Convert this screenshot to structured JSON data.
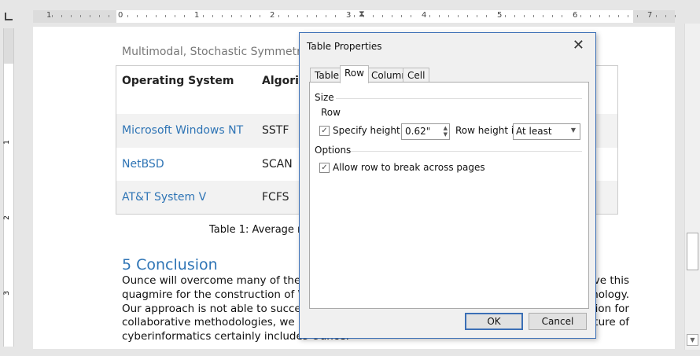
{
  "ruler": {
    "numbers_left": [
      "1"
    ],
    "numbers": [
      "0",
      "1",
      "2",
      "3",
      "4",
      "5",
      "6",
      "7"
    ],
    "vertical_numbers": [
      "1",
      "2",
      "3"
    ]
  },
  "document": {
    "running_header": "Multimodal, Stochastic Symmetries f",
    "table": {
      "headers": [
        "Operating System",
        "Algorit"
      ],
      "rows": [
        [
          "Microsoft Windows NT",
          "SSTF"
        ],
        [
          "NetBSD",
          "SCAN"
        ],
        [
          "AT&T System V",
          "FCFS"
        ]
      ]
    },
    "caption": "Table 1: Average res",
    "section_heading": "5 Conclusion",
    "paragraph_left": [
      "Ounce will overcome many of the g",
      "quagmire for the construction of Web",
      "Our approach is not able to successf",
      "collaborative methodologies, we intro",
      "cyberinformatics certainly includes Ounce."
    ],
    "paragraph_right": [
      "ve this",
      "nology.",
      "sion for",
      "uture of"
    ]
  },
  "dialog": {
    "title": "Table Properties",
    "close_icon": "close-icon",
    "tabs": [
      {
        "label": "Table"
      },
      {
        "label": "Row",
        "active": true
      },
      {
        "label": "Column"
      },
      {
        "label": "Cell"
      }
    ],
    "size_group": "Size",
    "row_label": "Row",
    "specify_height": {
      "label": "Specify height:",
      "checked": true,
      "value": "0.62\""
    },
    "row_height_is": {
      "label": "Row height is:",
      "value": "At least"
    },
    "options_group": "Options",
    "allow_break": {
      "label": "Allow row to break across pages",
      "checked": true
    },
    "ok": "OK",
    "cancel": "Cancel"
  },
  "colors": {
    "accent": "#2e74b5",
    "dialog_border": "#3b6fb6"
  }
}
